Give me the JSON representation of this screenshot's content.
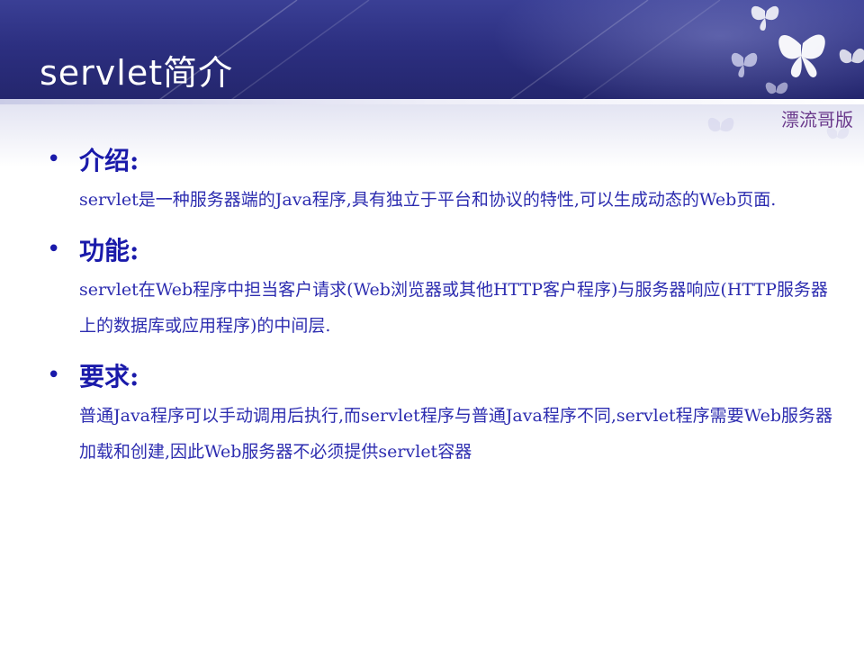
{
  "slide": {
    "title": "servlet简介",
    "watermark": "漂流哥版"
  },
  "sections": [
    {
      "heading": "介绍:",
      "text": "servlet是一种服务器端的Java程序,具有独立于平台和协议的特性,可以生成动态的Web页面."
    },
    {
      "heading": "功能:",
      "text": "servlet在Web程序中担当客户请求(Web浏览器或其他HTTP客户程序)与服务器响应(HTTP服务器上的数据库或应用程序)的中间层."
    },
    {
      "heading": "要求:",
      "text": "普通Java程序可以手动调用后执行,而servlet程序与普通Java程序不同,servlet程序需要Web服务器加载和创建,因此Web服务器不必须提供servlet容器"
    }
  ],
  "colors": {
    "header": "#2c2f80",
    "heading": "#1a1aaa",
    "body_text": "#2d2db0",
    "watermark": "#6b3a8c"
  },
  "icons": [
    "butterfly-icon",
    "bullet-dot-icon"
  ]
}
